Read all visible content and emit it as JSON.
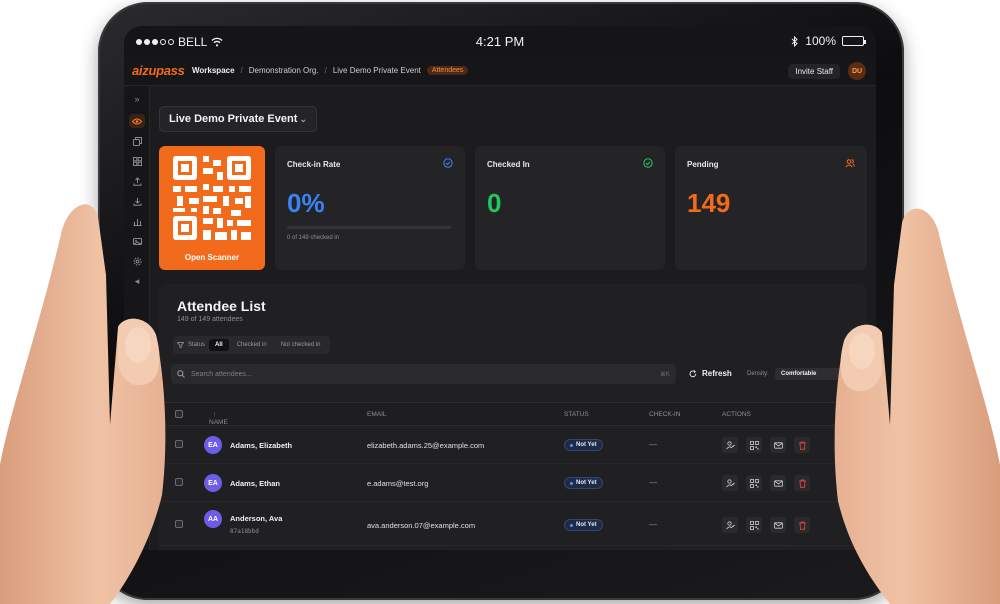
{
  "status_bar": {
    "carrier": "BELL",
    "time": "4:21 PM",
    "battery": "100%"
  },
  "header": {
    "logo": "aizupass",
    "breadcrumb": [
      "Workspace",
      "Demonstration Org.",
      "Live Demo Private Event"
    ],
    "breadcrumb_badge": "Attendees",
    "invite_label": "Invite Staff",
    "user_initials": "DU"
  },
  "sidebar": {
    "collapse_label": "»",
    "expand_label": "◂"
  },
  "event_selector": {
    "value": "Live Demo Private Event"
  },
  "scanner": {
    "label": "Open Scanner"
  },
  "stats": [
    {
      "title": "Check-in Rate",
      "value": "0%",
      "sub": "0 of 149 checked in",
      "progress": 0,
      "color": "#3b82f6"
    },
    {
      "title": "Checked In",
      "value": "0",
      "color": "#22c55e"
    },
    {
      "title": "Pending",
      "value": "149",
      "color": "#f26a1b"
    }
  ],
  "attendee_list": {
    "title": "Attendee List",
    "count": "149 of 149 attendees",
    "filter_label": "Status",
    "filters": [
      "All",
      "Checked in",
      "Not checked in"
    ],
    "search_placeholder": "Search attendees...",
    "search_shortcut": "⌘K",
    "refresh_label": "Refresh",
    "density_label": "Density:",
    "density_value": "Comfortable",
    "columns": {
      "name": "NAME",
      "email": "EMAIL",
      "status": "STATUS",
      "checkin": "CHECK-IN",
      "actions": "ACTIONS"
    },
    "rows": [
      {
        "initials": "EA",
        "name": "Adams, Elizabeth",
        "id": "",
        "email": "elizabeth.adams.25@example.com",
        "status": "Not Yet",
        "checkin": "—"
      },
      {
        "initials": "EA",
        "name": "Adams, Ethan",
        "id": "",
        "email": "e.adams@test.org",
        "status": "Not Yet",
        "checkin": "—"
      },
      {
        "initials": "AA",
        "name": "Anderson, Ava",
        "id": "87a18bbd",
        "email": "ava.anderson.07@example.com",
        "status": "Not Yet",
        "checkin": "—"
      }
    ]
  }
}
